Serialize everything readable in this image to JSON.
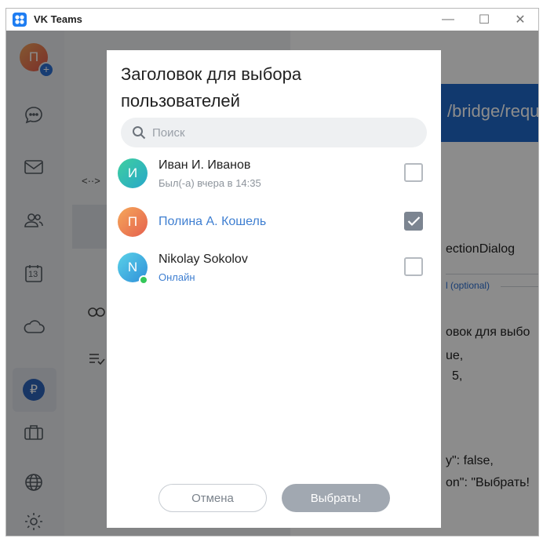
{
  "window": {
    "title": "VK Teams",
    "min_label": "—",
    "max_label": "☐",
    "close_label": "✕"
  },
  "rail": {
    "avatar_letter": "П",
    "add_label": "+",
    "calendar_day": "13",
    "ruble_symbol": "₽"
  },
  "background": {
    "header_text": "/bridge/requ",
    "code_lines": [
      "ectionDialog",
      "овок для выбо",
      "ue,",
      "5,",
      "y\": false,",
      "on\": \"Выбрать!"
    ],
    "optional_label": "l (optional)",
    "code_icon": "<··>"
  },
  "dialog": {
    "title": "Заголовок для выбора пользователей",
    "search_placeholder": "Поиск",
    "users": [
      {
        "initial": "И",
        "name": "Иван И. Иванов",
        "status": "Был(-а) вчера в 14:35",
        "checked": false,
        "online": false
      },
      {
        "initial": "П",
        "name": "Полина А. Кошель",
        "status": "",
        "checked": true,
        "online": false
      },
      {
        "initial": "N",
        "name": "Nikolay Sokolov",
        "status": "Онлайн",
        "checked": false,
        "online": true
      }
    ],
    "cancel_label": "Отмена",
    "confirm_label": "Выбрать!"
  },
  "colors": {
    "accent": "#3f7fd1",
    "online": "#34c759",
    "brand": "#1e7df2"
  }
}
